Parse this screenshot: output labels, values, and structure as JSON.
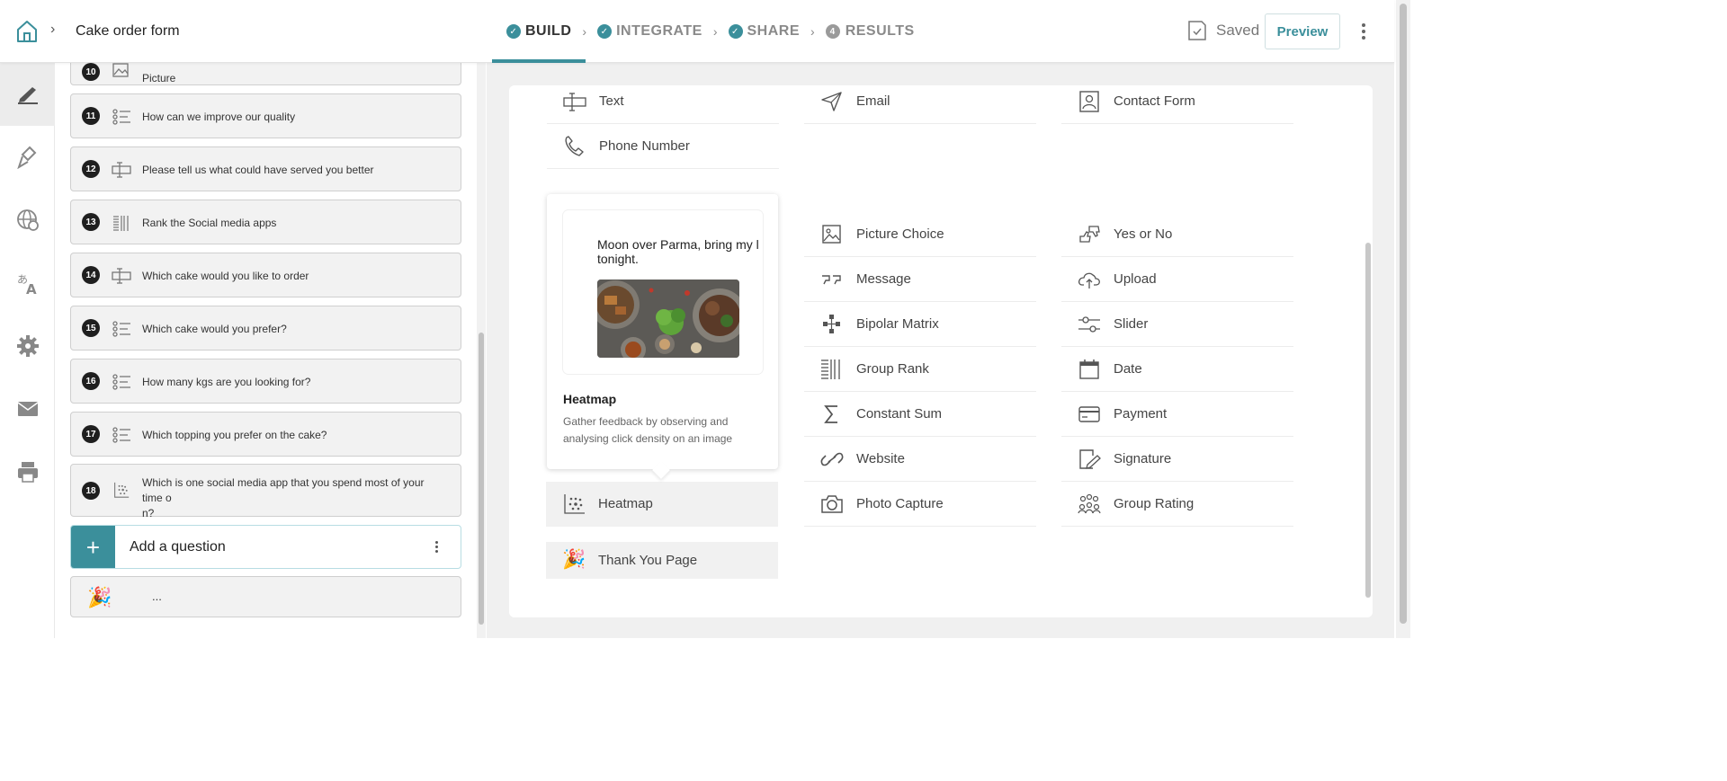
{
  "header": {
    "form_title": "Cake order form",
    "steps": [
      {
        "label": "BUILD",
        "marker": "✓",
        "state": "active"
      },
      {
        "label": "INTEGRATE",
        "marker": "✓",
        "state": "done"
      },
      {
        "label": "SHARE",
        "marker": "✓",
        "state": "done"
      },
      {
        "label": "RESULTS",
        "marker": "4",
        "state": "pending"
      }
    ],
    "saved_label": "Saved",
    "preview_label": "Preview"
  },
  "sidebar": {
    "items": [
      {
        "icon": "edit-icon",
        "active": true
      },
      {
        "icon": "paint-brush-icon"
      },
      {
        "icon": "globe-icon"
      },
      {
        "icon": "translate-icon"
      },
      {
        "icon": "gear-icon"
      },
      {
        "icon": "mail-icon"
      },
      {
        "icon": "print-icon"
      }
    ]
  },
  "questions": [
    {
      "number": "10",
      "icon": "picture-icon",
      "text": "Picture"
    },
    {
      "number": "11",
      "icon": "multiple-choice-icon",
      "text": "How can we improve our quality"
    },
    {
      "number": "12",
      "icon": "text-input-icon",
      "text": "Please tell us what could have served you better"
    },
    {
      "number": "13",
      "icon": "rank-icon",
      "text": "Rank the Social media apps"
    },
    {
      "number": "14",
      "icon": "text-input-icon",
      "text": "Which cake would you like to order"
    },
    {
      "number": "15",
      "icon": "multiple-choice-icon",
      "text": "Which cake would you prefer?"
    },
    {
      "number": "16",
      "icon": "multiple-choice-icon",
      "text": "How many kgs are you looking for?"
    },
    {
      "number": "17",
      "icon": "multiple-choice-icon",
      "text": "Which topping you prefer on the cake?"
    },
    {
      "number": "18",
      "icon": "heatmap-icon",
      "text": "Which is one social media app that you spend most of your time o\nn?"
    }
  ],
  "add_question": {
    "label": "Add a question"
  },
  "end_page": {
    "text": "..."
  },
  "question_types": {
    "top_row": [
      {
        "label": "Text",
        "icon": "text-input-icon"
      },
      {
        "label": "Email",
        "icon": "send-icon"
      },
      {
        "label": "Contact Form",
        "icon": "contact-form-icon"
      },
      {
        "label": "Phone Number",
        "icon": "phone-icon"
      }
    ],
    "col2": [
      {
        "label": "Picture Choice",
        "icon": "picture-icon"
      },
      {
        "label": "Message",
        "icon": "quote-icon"
      },
      {
        "label": "Bipolar Matrix",
        "icon": "bipolar-matrix-icon"
      },
      {
        "label": "Group Rank",
        "icon": "rank-icon"
      },
      {
        "label": "Constant Sum",
        "icon": "sigma-icon"
      },
      {
        "label": "Website",
        "icon": "link-icon"
      },
      {
        "label": "Photo Capture",
        "icon": "camera-icon"
      }
    ],
    "col3": [
      {
        "label": "Yes or No",
        "icon": "thumbs-icon"
      },
      {
        "label": "Upload",
        "icon": "upload-icon"
      },
      {
        "label": "Slider",
        "icon": "slider-icon"
      },
      {
        "label": "Date",
        "icon": "calendar-icon"
      },
      {
        "label": "Payment",
        "icon": "card-icon"
      },
      {
        "label": "Signature",
        "icon": "signature-icon"
      },
      {
        "label": "Group Rating",
        "icon": "group-icon"
      }
    ],
    "heatmap": {
      "label": "Heatmap",
      "icon": "heatmap-icon"
    },
    "thank_you": {
      "label": "Thank You Page",
      "icon": "party-popper-icon"
    }
  },
  "tooltip": {
    "preview_question": "Moon over Parma, bring my l\ntonight.",
    "title": "Heatmap",
    "description": "Gather feedback by observing and analysing click density on an image"
  },
  "colors": {
    "accent": "#3b8f9b",
    "badge": "#1f1f1f"
  }
}
